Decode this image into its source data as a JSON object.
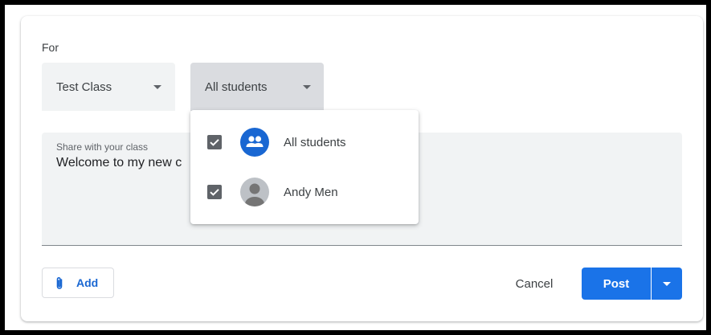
{
  "form": {
    "for_label": "For",
    "class_select": {
      "value": "Test Class"
    },
    "students_select": {
      "value": "All students"
    }
  },
  "share": {
    "placeholder": "Share with your class",
    "text": "Welcome to my new c"
  },
  "recipients_dropdown": {
    "items": [
      {
        "label": "All students",
        "checked": true,
        "avatar": "group-icon"
      },
      {
        "label": "Andy Men",
        "checked": true,
        "avatar": "person-avatar-icon"
      }
    ]
  },
  "actions": {
    "add_label": "Add",
    "cancel_label": "Cancel",
    "post_label": "Post"
  },
  "colors": {
    "accent": "#1a73e8",
    "link": "#1967d2",
    "field_bg": "#f1f3f4",
    "checkbox": "#5f6368"
  }
}
